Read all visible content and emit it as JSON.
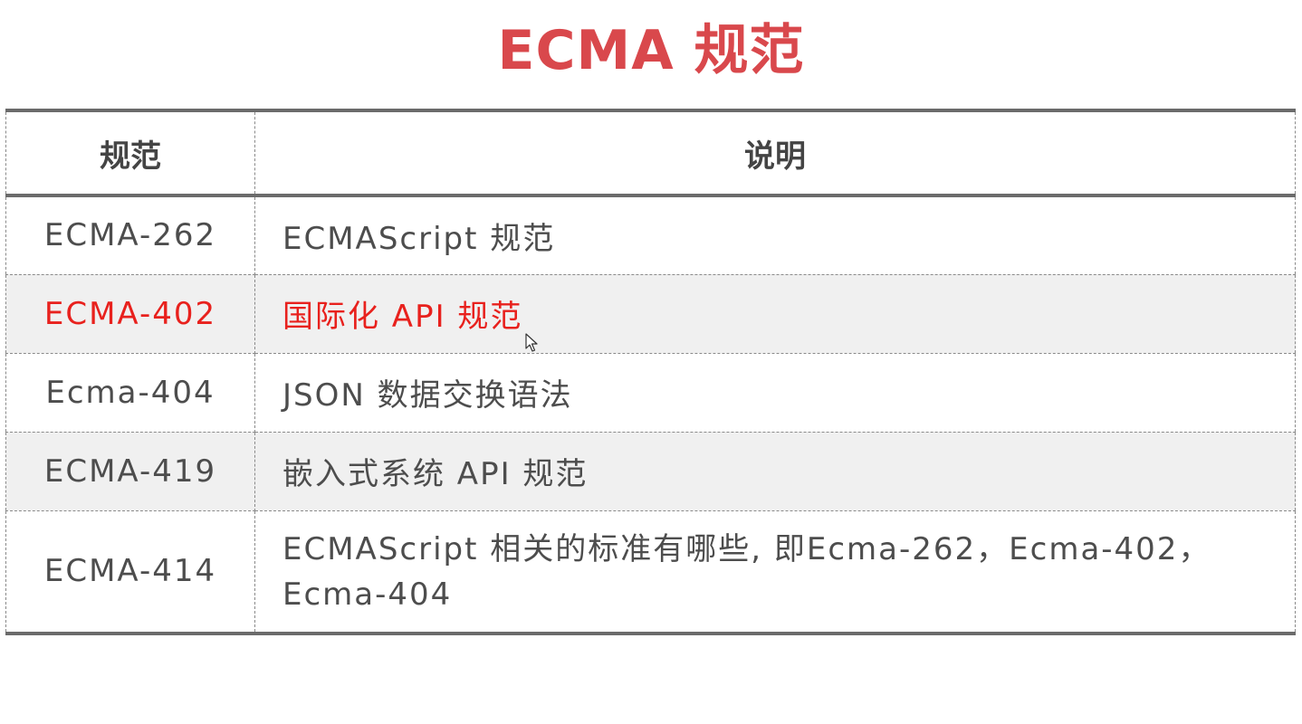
{
  "title": "ECMA 规范",
  "table": {
    "headers": [
      "规范",
      "说明"
    ],
    "rows": [
      {
        "code": "ECMA-262",
        "desc": "ECMAScript 规范"
      },
      {
        "code": "ECMA-402",
        "desc": "国际化 API 规范"
      },
      {
        "code": "Ecma-404",
        "desc": "JSON 数据交换语法"
      },
      {
        "code": "ECMA-419",
        "desc": "嵌入式系统 API 规范"
      },
      {
        "code": "ECMA-414",
        "desc": "ECMAScript 相关的标准有哪些, 即Ecma-262，Ecma-402，Ecma-404"
      }
    ]
  },
  "colors": {
    "title": "#d9484c",
    "highlight": "#e8211d",
    "text": "#4d4d4d",
    "shaded_row": "#f0f0f0",
    "rule": "#6b6b6b"
  },
  "icons": {
    "cursor": "mouse-pointer-icon"
  }
}
